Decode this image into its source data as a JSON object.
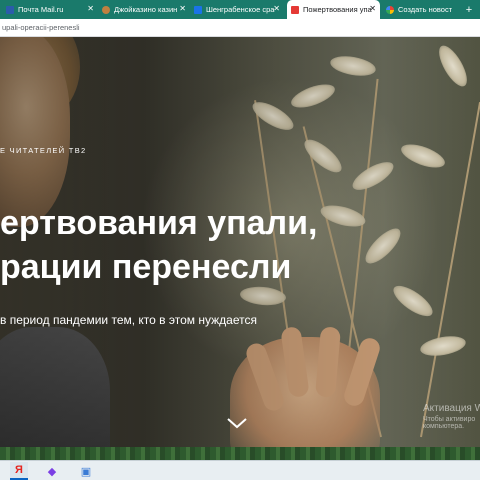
{
  "browser": {
    "tabs": [
      {
        "title": "Почта Mail.ru",
        "favicon_color": "#2b5cab",
        "active": false
      },
      {
        "title": "Джойказино казин",
        "favicon_color": "#c08040",
        "active": false
      },
      {
        "title": "Шенграбенское сра",
        "favicon_color": "#1a73e8",
        "active": false
      },
      {
        "title": "Пожертвования упа",
        "favicon_color": "#e53935",
        "active": true
      },
      {
        "title": "Создать новость",
        "favicon_color": "#f4b400",
        "active": false
      }
    ],
    "new_tab_symbol": "+",
    "url": "upali-operacii-perenesli"
  },
  "article": {
    "eyebrow": "Е ЧИТАТЕЛЕЙ ТВ2",
    "headline_line1": "ертвования упали,",
    "headline_line2": "рации перенесли",
    "subtitle": "в период пандемии тем, кто в этом нуждается",
    "scroll_icon": "chevron-down-icon"
  },
  "windows_activation": {
    "title": "Активация W",
    "line": "Чтобы активиро компьютера."
  },
  "taskbar": {
    "apps": [
      {
        "name": "yandex-browser",
        "glyph": "Я",
        "color": "#e52620",
        "active": true
      },
      {
        "name": "app-2",
        "glyph": "◆",
        "color": "#7b3fe4",
        "active": false
      },
      {
        "name": "app-3",
        "glyph": "▣",
        "color": "#3a7bd5",
        "active": false
      }
    ]
  }
}
